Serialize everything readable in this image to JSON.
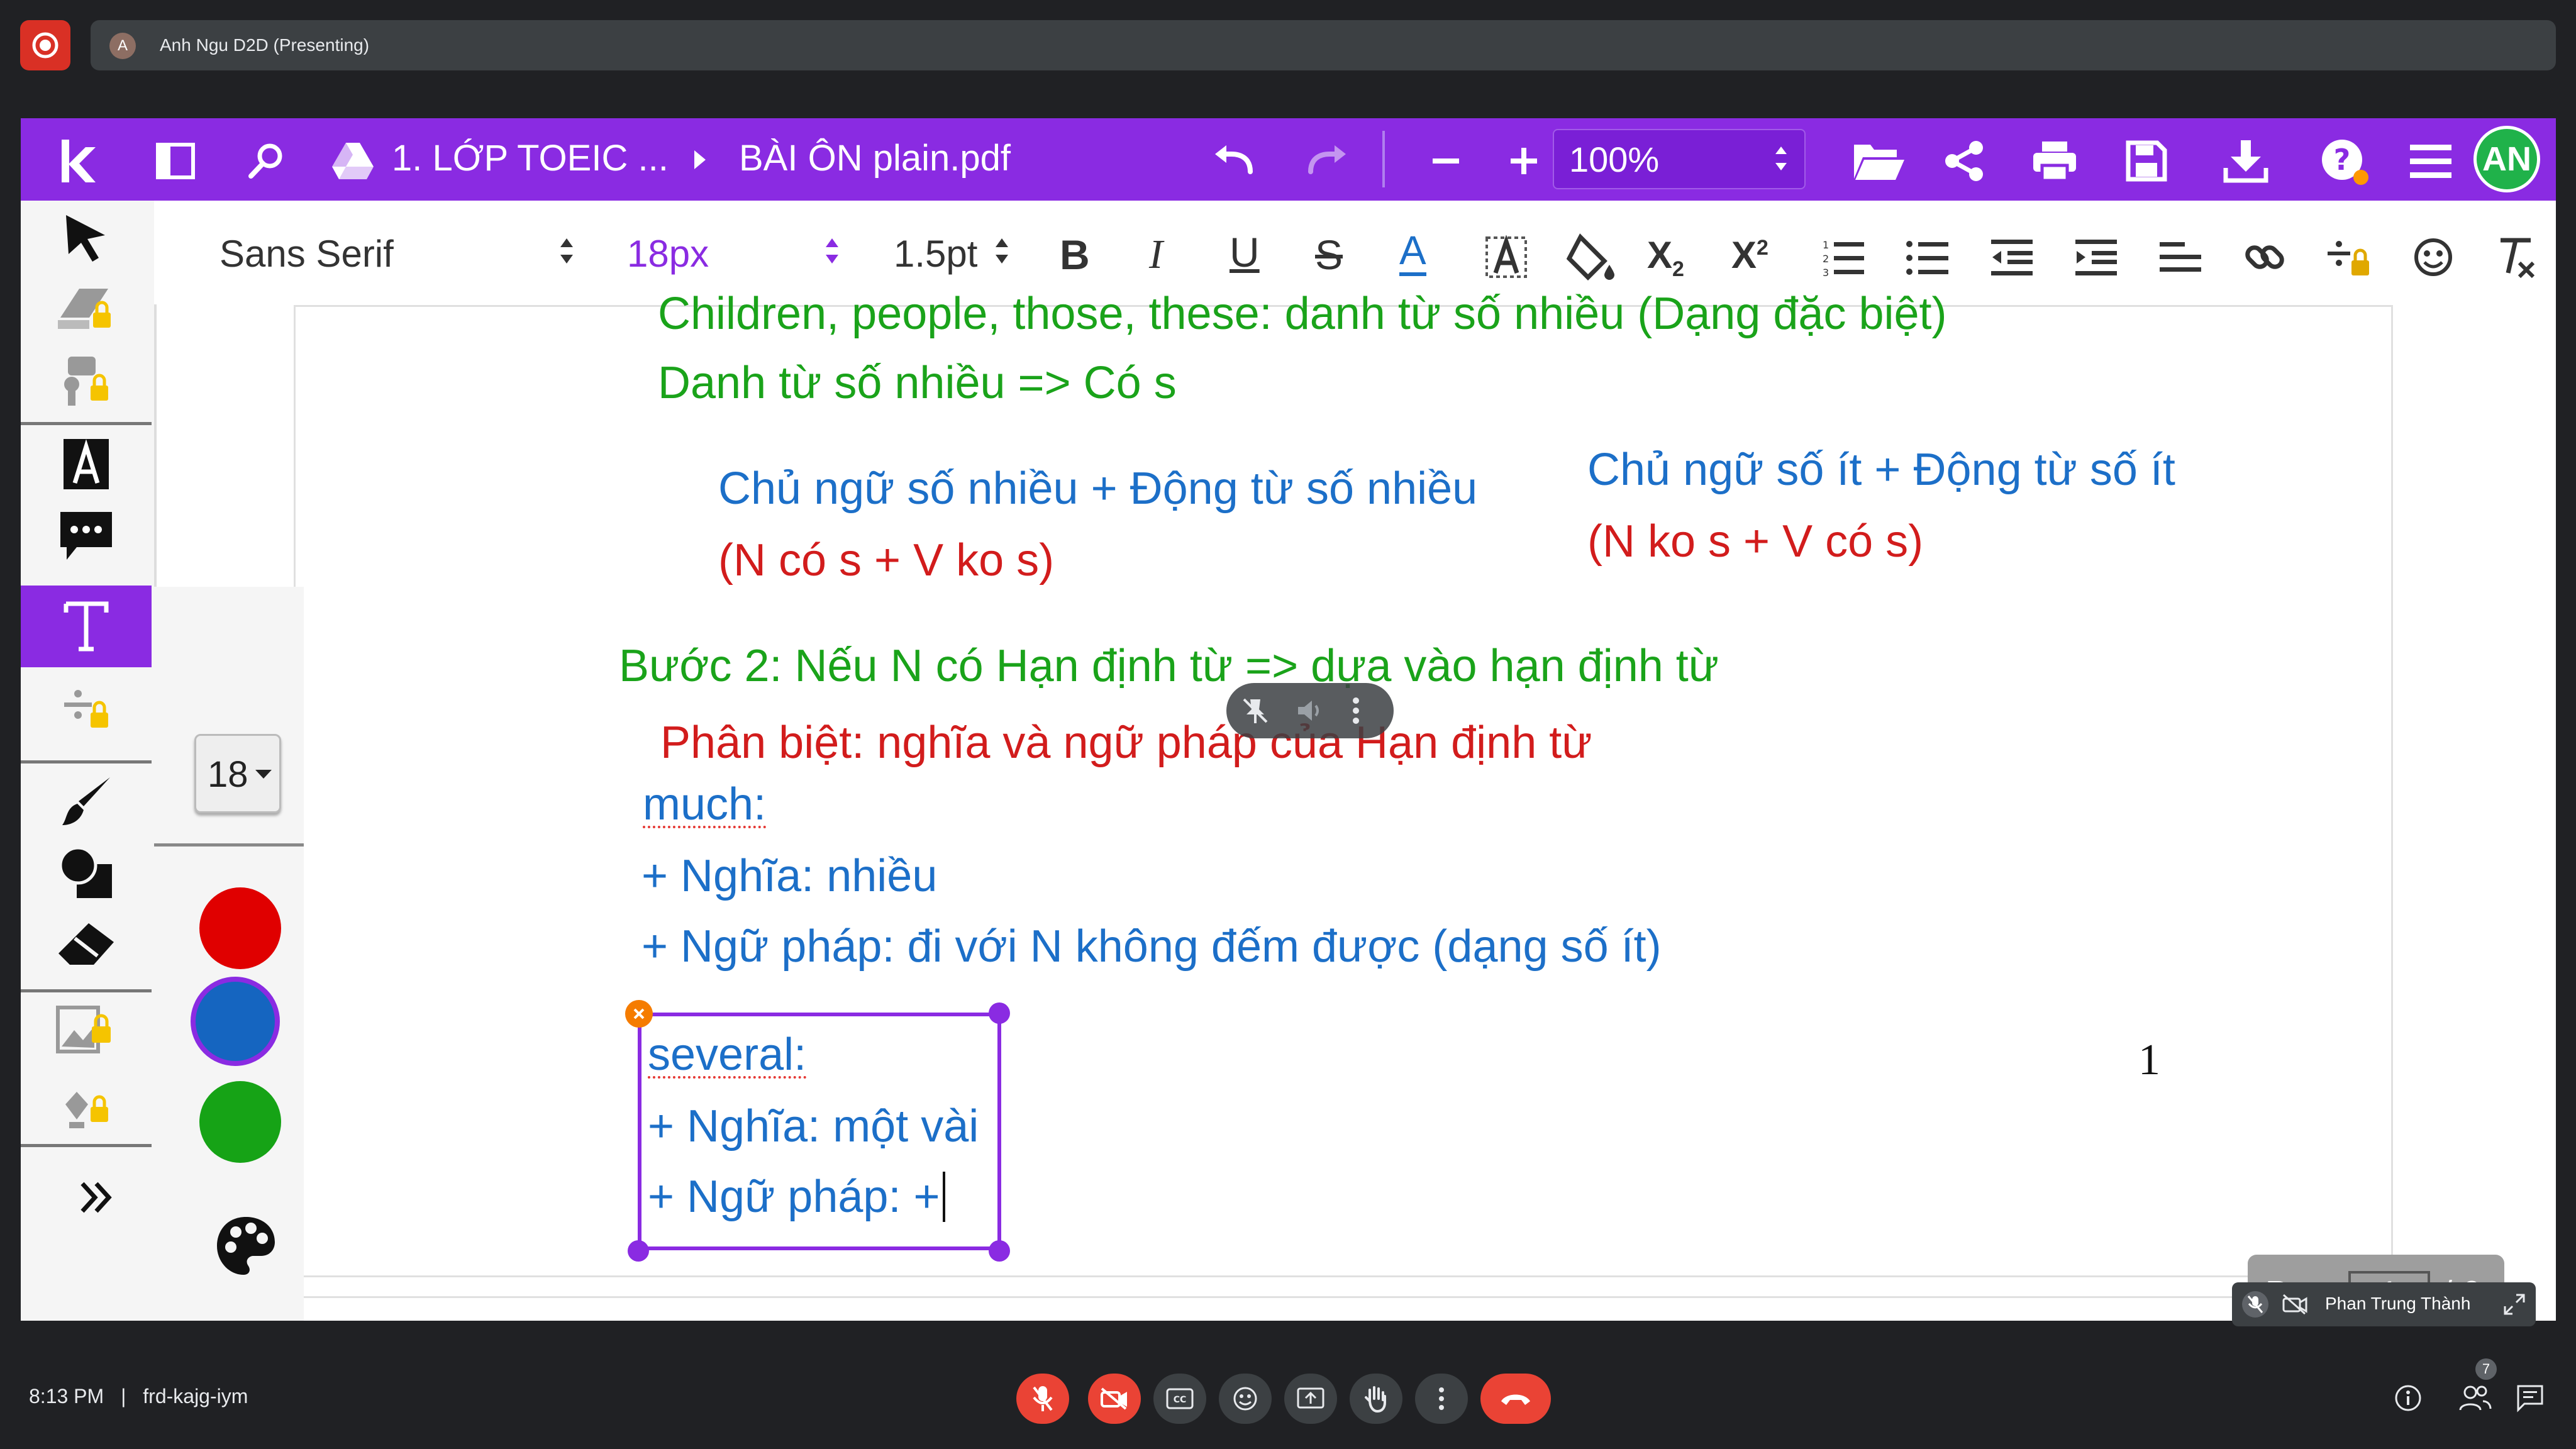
{
  "meeting": {
    "presenter_initial": "A",
    "presenter_label": "Anh Ngu D2D (Presenting)",
    "time": "8:13 PM",
    "separator": "|",
    "meeting_code": "frd-kajg-iym",
    "participant_name": "Phan Trung Thành",
    "participant_count": "7"
  },
  "app": {
    "breadcrumb_folder": "1. LỚP TOEIC ...",
    "file_name": "BÀI ÔN plain.pdf",
    "zoom": "100%",
    "avatar": "AN"
  },
  "format_toolbar": {
    "font": "Sans Serif",
    "size": "18px",
    "line_height": "1.5pt",
    "bold": "B",
    "italic": "I",
    "underline": "U",
    "strike": "S",
    "color": "A",
    "subscript": "X",
    "sub_mark": "2",
    "superscript": "X",
    "sup_mark": "2"
  },
  "side_panel": {
    "font_size": "18",
    "colors": [
      "#e00000",
      "#1565c0",
      "#16a316"
    ]
  },
  "document": {
    "line1": "Children, people,  those, these: danh từ số nhiều (Dạng đặc biệt)",
    "line2": "Danh từ số nhiều => Có s",
    "plural_rule": "Chủ ngữ số nhiều + Động từ số nhiều",
    "plural_note": "(N có s + V ko s)",
    "singular_rule": "Chủ ngữ số ít + Động từ số ít",
    "singular_note": "(N ko s + V có s)",
    "step2": "Bước 2: Nếu N có Hạn định từ => dựa vào hạn định từ",
    "distinguish": "Phân biệt: nghĩa và ngữ pháp của Hạn định từ",
    "much": "much:",
    "much_meaning": "+ Nghĩa: nhiều",
    "much_grammar": "+ Ngữ pháp: đi với N không đếm được (dạng số ít)",
    "several": "several:",
    "several_meaning": "+ Nghĩa: một vài",
    "several_grammar": "+ Ngữ pháp: +",
    "page_number": "1"
  },
  "pagination": {
    "label": "Page",
    "current": "1",
    "total": "/ 6"
  },
  "accent_colors": {
    "toolbar": "#8a2be2",
    "end_call": "#ea4335",
    "green_text": "#1aa31a",
    "blue_text": "#1c6fc8",
    "red_text": "#d21c1c"
  }
}
